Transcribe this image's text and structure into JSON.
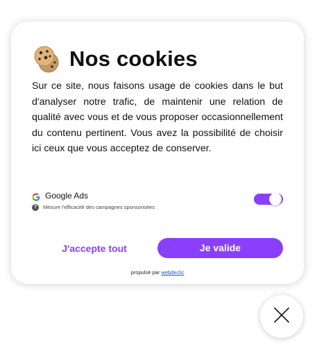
{
  "modal": {
    "title": "Nos cookies",
    "cookie_icon": "cookie-icon",
    "body": "Sur ce site, nous faisons usage de cookies dans le but d'analyser notre trafic, de maintenir une relation de qualité avec vous et de vous proposer occasionnellement du contenu pertinent. Vous avez la possibilité de choisir ici ceux que vous acceptez de conserver.",
    "consents": [
      {
        "icon": "google-icon",
        "name": "Google Ads",
        "description": "Mesure l'efficacité des campagnes sponsorisées",
        "enabled": true
      }
    ],
    "accept_all_label": "J'accepte tout",
    "validate_label": "Je valide",
    "powered_prefix": "propulsé par",
    "powered_link": "webdeclic"
  },
  "close_icon": "close-icon",
  "colors": {
    "accent": "#8a3ffc",
    "text": "#111111",
    "background": "#ffffff"
  }
}
